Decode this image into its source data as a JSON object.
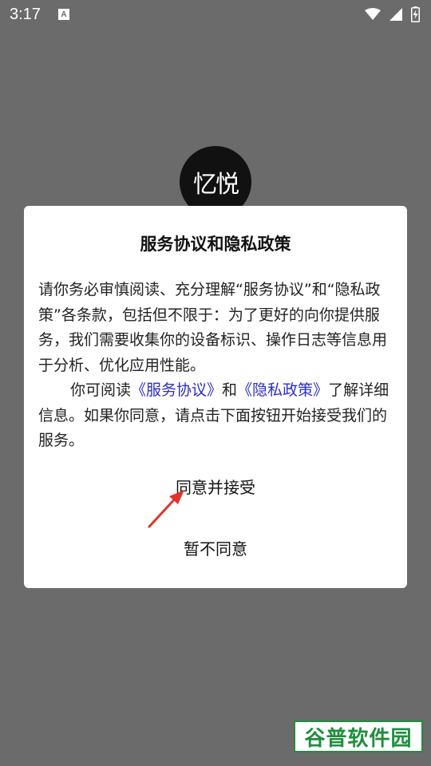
{
  "status_bar": {
    "time": "3:17",
    "notification_icon": "A"
  },
  "app_logo_text": "忆悦",
  "dialog": {
    "title": "服务协议和隐私政策",
    "paragraph1": "请你务必审慎阅读、充分理解“服务协议”和“隐私政策”各条款，包括但不限于：为了更好的向你提供服务，我们需要收集你的设备标识、操作日志等信息用于分析、优化应用性能。",
    "p2_prefix": "你可阅读",
    "service_link": "《服务协议》",
    "p2_and": "和",
    "privacy_link": "《隐私政策》",
    "p2_suffix": "了解详细信息。如果你同意，请点击下面按钮开始接受我们的服务。",
    "agree_label": "同意并接受",
    "decline_label": "暂不同意"
  },
  "watermark": "谷普软件园",
  "colors": {
    "overlay": "#6b6b6b",
    "link": "#2b2ec8",
    "arrow": "#e0352b",
    "watermark_green": "#1e8e3e"
  }
}
